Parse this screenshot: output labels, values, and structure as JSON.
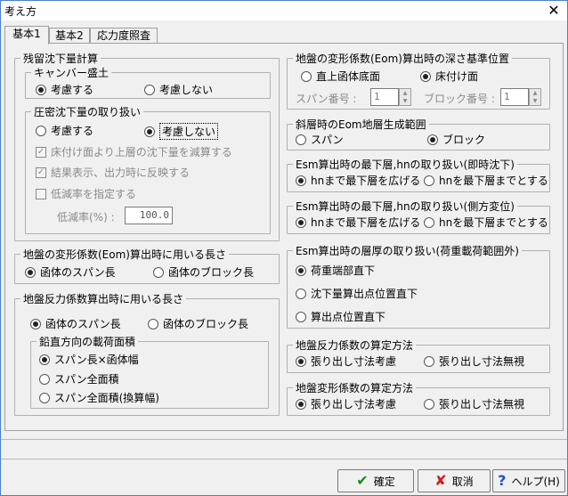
{
  "window": {
    "title": "考え方",
    "close_glyph": "✕"
  },
  "tabs": [
    {
      "label": "基本1",
      "active": true
    },
    {
      "label": "基本2",
      "active": false
    },
    {
      "label": "応力度照査",
      "active": false
    }
  ],
  "left": {
    "residual": {
      "label": "残留沈下量計算",
      "camber": {
        "label": "キャンバー盛土",
        "consider": "考慮する",
        "not_consider": "考慮しない",
        "selected": "consider"
      },
      "consolidation": {
        "label": "圧密沈下量の取り扱い",
        "consider": "考慮する",
        "not_consider": "考慮しない",
        "selected": "not_consider",
        "check_subtract": "床付け面より上層の沈下量を減算する",
        "check_reflect": "結果表示、出力時に反映する",
        "check_reduction": "低減率を指定する",
        "reduction_label": "低減率(%) :",
        "reduction_value": "100.0"
      }
    },
    "eom_length": {
      "label": "地盤の変形係数(Eom)算出時に用いる長さ",
      "span": "函体のスパン長",
      "block": "函体のブロック長",
      "selected": "span"
    },
    "reaction_length": {
      "label": "地盤反力係数算出時に用いる長さ",
      "span": "函体のスパン長",
      "block": "函体のブロック長",
      "selected": "span",
      "area": {
        "label": "鉛直方向の載荷面積",
        "opt1": "スパン長×函体幅",
        "opt2": "スパン全面積",
        "opt3": "スパン全面積(換算幅)",
        "selected": "opt1"
      }
    }
  },
  "right": {
    "depth_base": {
      "label": "地盤の変形係数(Eom)算出時の深さ基準位置",
      "directly_below": "直上函体底面",
      "footing": "床付け面",
      "selected": "footing",
      "span_no_label": "スパン番号 :",
      "span_no_value": "1",
      "block_no_label": "ブロック番号 :",
      "block_no_value": "1"
    },
    "slope_range": {
      "label": "斜層時のEom地層生成範囲",
      "span": "スパン",
      "block": "ブロック",
      "selected": "block"
    },
    "esm_settle": {
      "label": "Esm算出時の最下層,hnの取り扱い(即時沈下)",
      "opt1": "hnまで最下層を広げる",
      "opt2": "hnを最下層までとする",
      "selected": "opt1"
    },
    "esm_lateral": {
      "label": "Esm算出時の最下層,hnの取り扱い(側方変位)",
      "opt1": "hnまで最下層を広げる",
      "opt2": "hnを最下層までとする",
      "selected": "opt1"
    },
    "esm_thickness": {
      "label": "Esm算出時の層厚の取り扱い(荷重載荷範囲外)",
      "opt1": "荷重端部直下",
      "opt2": "沈下量算出点位置直下",
      "opt3": "算出点位置直下",
      "selected": "opt1"
    },
    "reaction_method": {
      "label": "地盤反力係数の算定方法",
      "opt1": "張り出し寸法考慮",
      "opt2": "張り出し寸法無視",
      "selected": "opt1"
    },
    "deform_method": {
      "label": "地盤変形係数の算定方法",
      "opt1": "張り出し寸法考慮",
      "opt2": "張り出し寸法無視",
      "selected": "opt1"
    }
  },
  "buttons": {
    "ok": {
      "label": "確定",
      "icon": "check-icon"
    },
    "cancel": {
      "label": "取消",
      "icon": "x-icon"
    },
    "help": {
      "label": "ヘルプ(H)",
      "icon": "help-icon"
    }
  },
  "colors": {
    "ok_icon": "#1a8a1a",
    "cancel_icon": "#c81e1e",
    "help_icon": "#1e4fc8"
  }
}
